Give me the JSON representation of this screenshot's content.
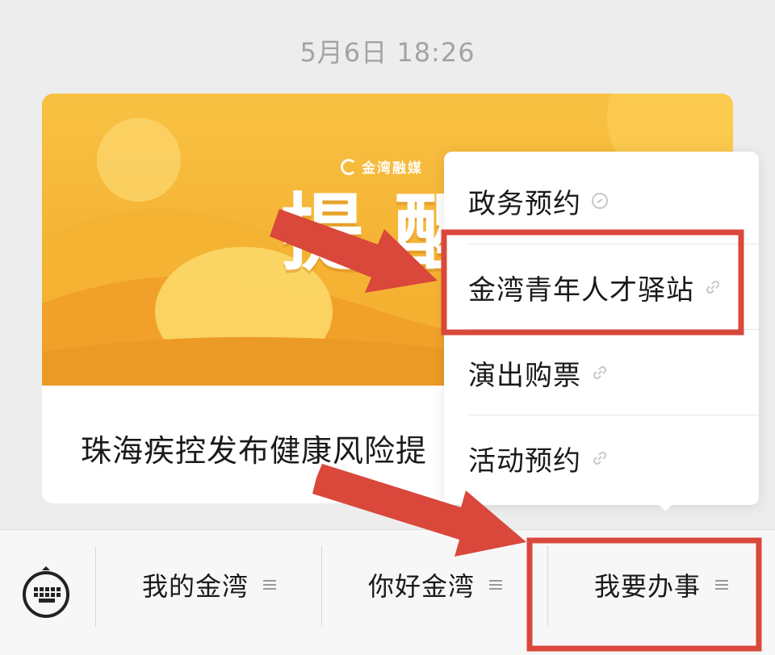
{
  "timestamp": "5月6日 18:26",
  "card": {
    "brand": "金湾融媒",
    "headline": "提醒",
    "title": "珠海疾控发布健康风险提"
  },
  "popup": {
    "items": [
      {
        "label": "政务预约",
        "icon": "link-icon"
      },
      {
        "label": "金湾青年人才驿站",
        "icon": "link-icon"
      },
      {
        "label": "演出购票",
        "icon": "link-icon"
      },
      {
        "label": "活动预约",
        "icon": "link-icon"
      }
    ]
  },
  "bottom_bar": {
    "keyboard_icon": "keyboard-icon",
    "tabs": [
      {
        "label": "我的金湾",
        "icon": "menu-lines-icon"
      },
      {
        "label": "你好金湾",
        "icon": "menu-lines-icon"
      },
      {
        "label": "我要办事",
        "icon": "menu-lines-icon"
      }
    ]
  },
  "colors": {
    "background": "#ededed",
    "banner": "#f8c142",
    "annotation_red": "#d9483b",
    "timestamp": "#a3a3a3"
  }
}
